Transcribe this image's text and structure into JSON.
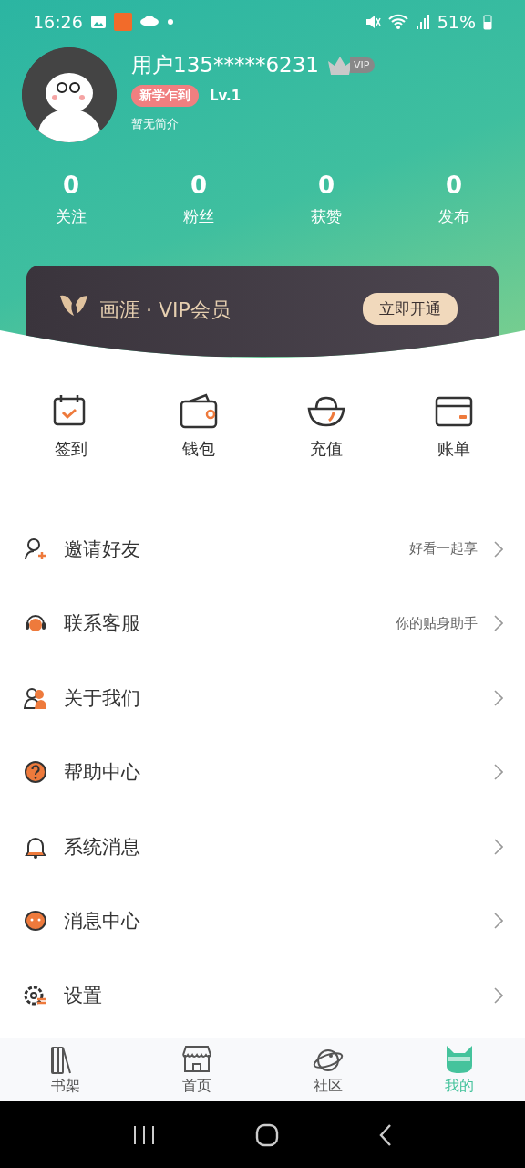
{
  "status_bar": {
    "time": "16:26",
    "battery": "51%"
  },
  "profile": {
    "name": "用户135*****6231",
    "vip_badge": "VIP",
    "tag": "新学乍到",
    "level": "Lv.1",
    "bio": "暂无简介"
  },
  "stats": [
    {
      "value": "0",
      "label": "关注"
    },
    {
      "value": "0",
      "label": "粉丝"
    },
    {
      "value": "0",
      "label": "获赞"
    },
    {
      "value": "0",
      "label": "发布"
    }
  ],
  "vip_card": {
    "title": "画涯 · VIP会员",
    "button": "立即开通"
  },
  "quick_actions": [
    {
      "kind": "checkin",
      "label": "签到"
    },
    {
      "kind": "wallet",
      "label": "钱包"
    },
    {
      "kind": "recharge",
      "label": "充值"
    },
    {
      "kind": "bill",
      "label": "账单"
    }
  ],
  "menu": [
    {
      "kind": "invite",
      "label": "邀请好友",
      "hint": "好看一起享"
    },
    {
      "kind": "service",
      "label": "联系客服",
      "hint": "你的贴身助手"
    },
    {
      "kind": "about",
      "label": "关于我们"
    },
    {
      "kind": "help",
      "label": "帮助中心"
    },
    {
      "kind": "notice",
      "label": "系统消息"
    },
    {
      "kind": "message",
      "label": "消息中心"
    },
    {
      "kind": "settings",
      "label": "设置"
    }
  ],
  "tabs": [
    {
      "kind": "shelf",
      "label": "书架",
      "selected": false
    },
    {
      "kind": "home",
      "label": "首页",
      "selected": false
    },
    {
      "kind": "community",
      "label": "社区",
      "selected": false
    },
    {
      "kind": "mine",
      "label": "我的",
      "selected": true
    }
  ]
}
